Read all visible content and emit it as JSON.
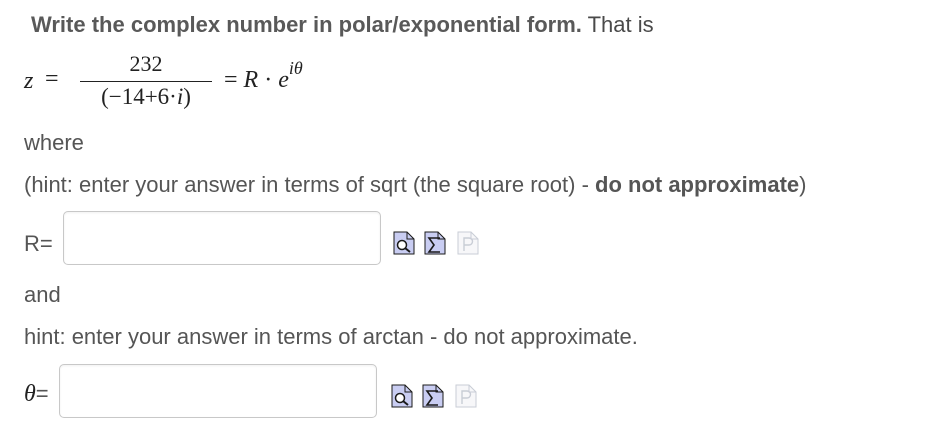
{
  "instruction": {
    "bold": "Write the complex number in polar/exponential form.",
    "rest": " That is"
  },
  "equation": {
    "lhs_var": "z",
    "equals": "=",
    "numerator": "232",
    "denominator_open": "(−14+6·",
    "denominator_i": "i",
    "denominator_close": ")",
    "rhs_equals": "= ",
    "rhs_R": "R",
    "rhs_dot": " · ",
    "rhs_e": "e",
    "rhs_exp": "iθ"
  },
  "where_text": "where",
  "hint1": {
    "prefix": "(hint: enter your answer in terms of sqrt (the square root) -  ",
    "bold": "do not approximate",
    "suffix": ")"
  },
  "r_field": {
    "label": "R=",
    "value": ""
  },
  "and_text": "and",
  "hint2": "hint: enter your answer in terms of arctan - do not approximate.",
  "theta_field": {
    "label_symbol": "θ",
    "label_suffix": "=",
    "value": ""
  },
  "icons": {
    "preview": "preview-icon",
    "equation_editor": "equation-editor-icon",
    "disabled_p": "p-icon"
  },
  "colors": {
    "icon_fill": "#c9cdf2",
    "icon_stroke": "#1a1a1a",
    "disabled_stroke": "#c9cdd6"
  }
}
